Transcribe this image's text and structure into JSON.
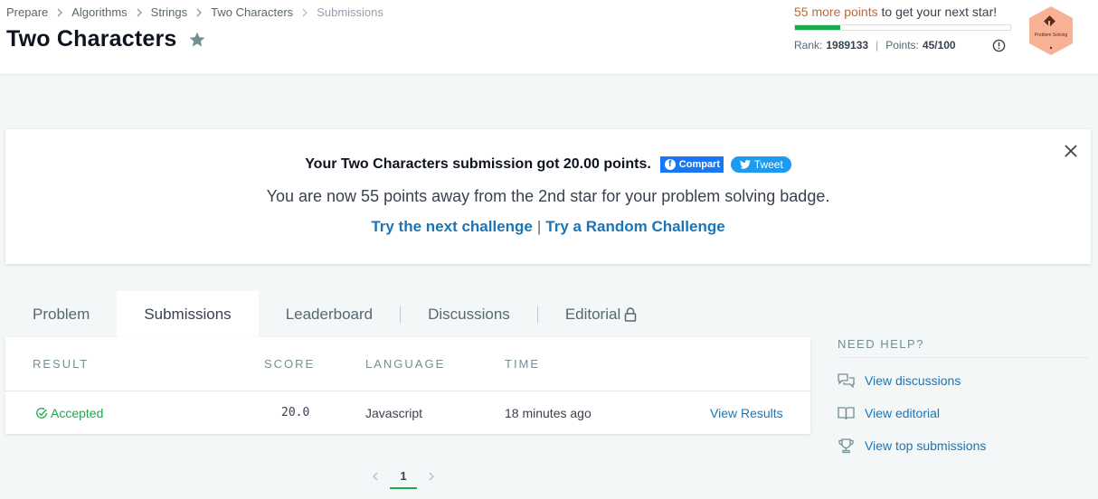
{
  "breadcrumb": [
    {
      "label": "Prepare"
    },
    {
      "label": "Algorithms"
    },
    {
      "label": "Strings"
    },
    {
      "label": "Two Characters"
    },
    {
      "label": "Submissions"
    }
  ],
  "page_title": "Two Characters",
  "progress": {
    "more_points": "55 more points",
    "next_star_suffix": "to get your next star!",
    "fill_fraction": 0.21,
    "rank_label": "Rank:",
    "rank_value": "1989133",
    "points_label": "Points:",
    "points_value": "45/100",
    "badge_text": "Problem Solving"
  },
  "notice": {
    "message": "Your Two Characters submission got 20.00 points.",
    "fb_label": "Compart",
    "tweet_label": "Tweet",
    "sub_message": "You are now 55 points away from the 2nd star for your problem solving badge.",
    "next_challenge": "Try the next challenge",
    "separator": "|",
    "random_challenge": "Try a Random Challenge"
  },
  "tabs": [
    {
      "label": "Problem"
    },
    {
      "label": "Submissions"
    },
    {
      "label": "Leaderboard"
    },
    {
      "label": "Discussions"
    },
    {
      "label": "Editorial"
    }
  ],
  "table": {
    "headers": [
      "RESULT",
      "SCORE",
      "LANGUAGE",
      "TIME"
    ],
    "rows": [
      {
        "result": "Accepted",
        "score": "20.0",
        "language": "Javascript",
        "time": "18 minutes ago",
        "action": "View Results"
      }
    ]
  },
  "pagination": {
    "current": "1"
  },
  "help": {
    "title": "NEED HELP?",
    "items": [
      {
        "label": "View discussions",
        "icon": "discussions-icon"
      },
      {
        "label": "View editorial",
        "icon": "book-icon"
      },
      {
        "label": "View top submissions",
        "icon": "trophy-icon"
      }
    ]
  },
  "colors": {
    "accent_green": "#1ba94c",
    "link_blue": "#1a75b8",
    "points_orange": "#c3682f",
    "badge_bg": "#f8b195"
  }
}
